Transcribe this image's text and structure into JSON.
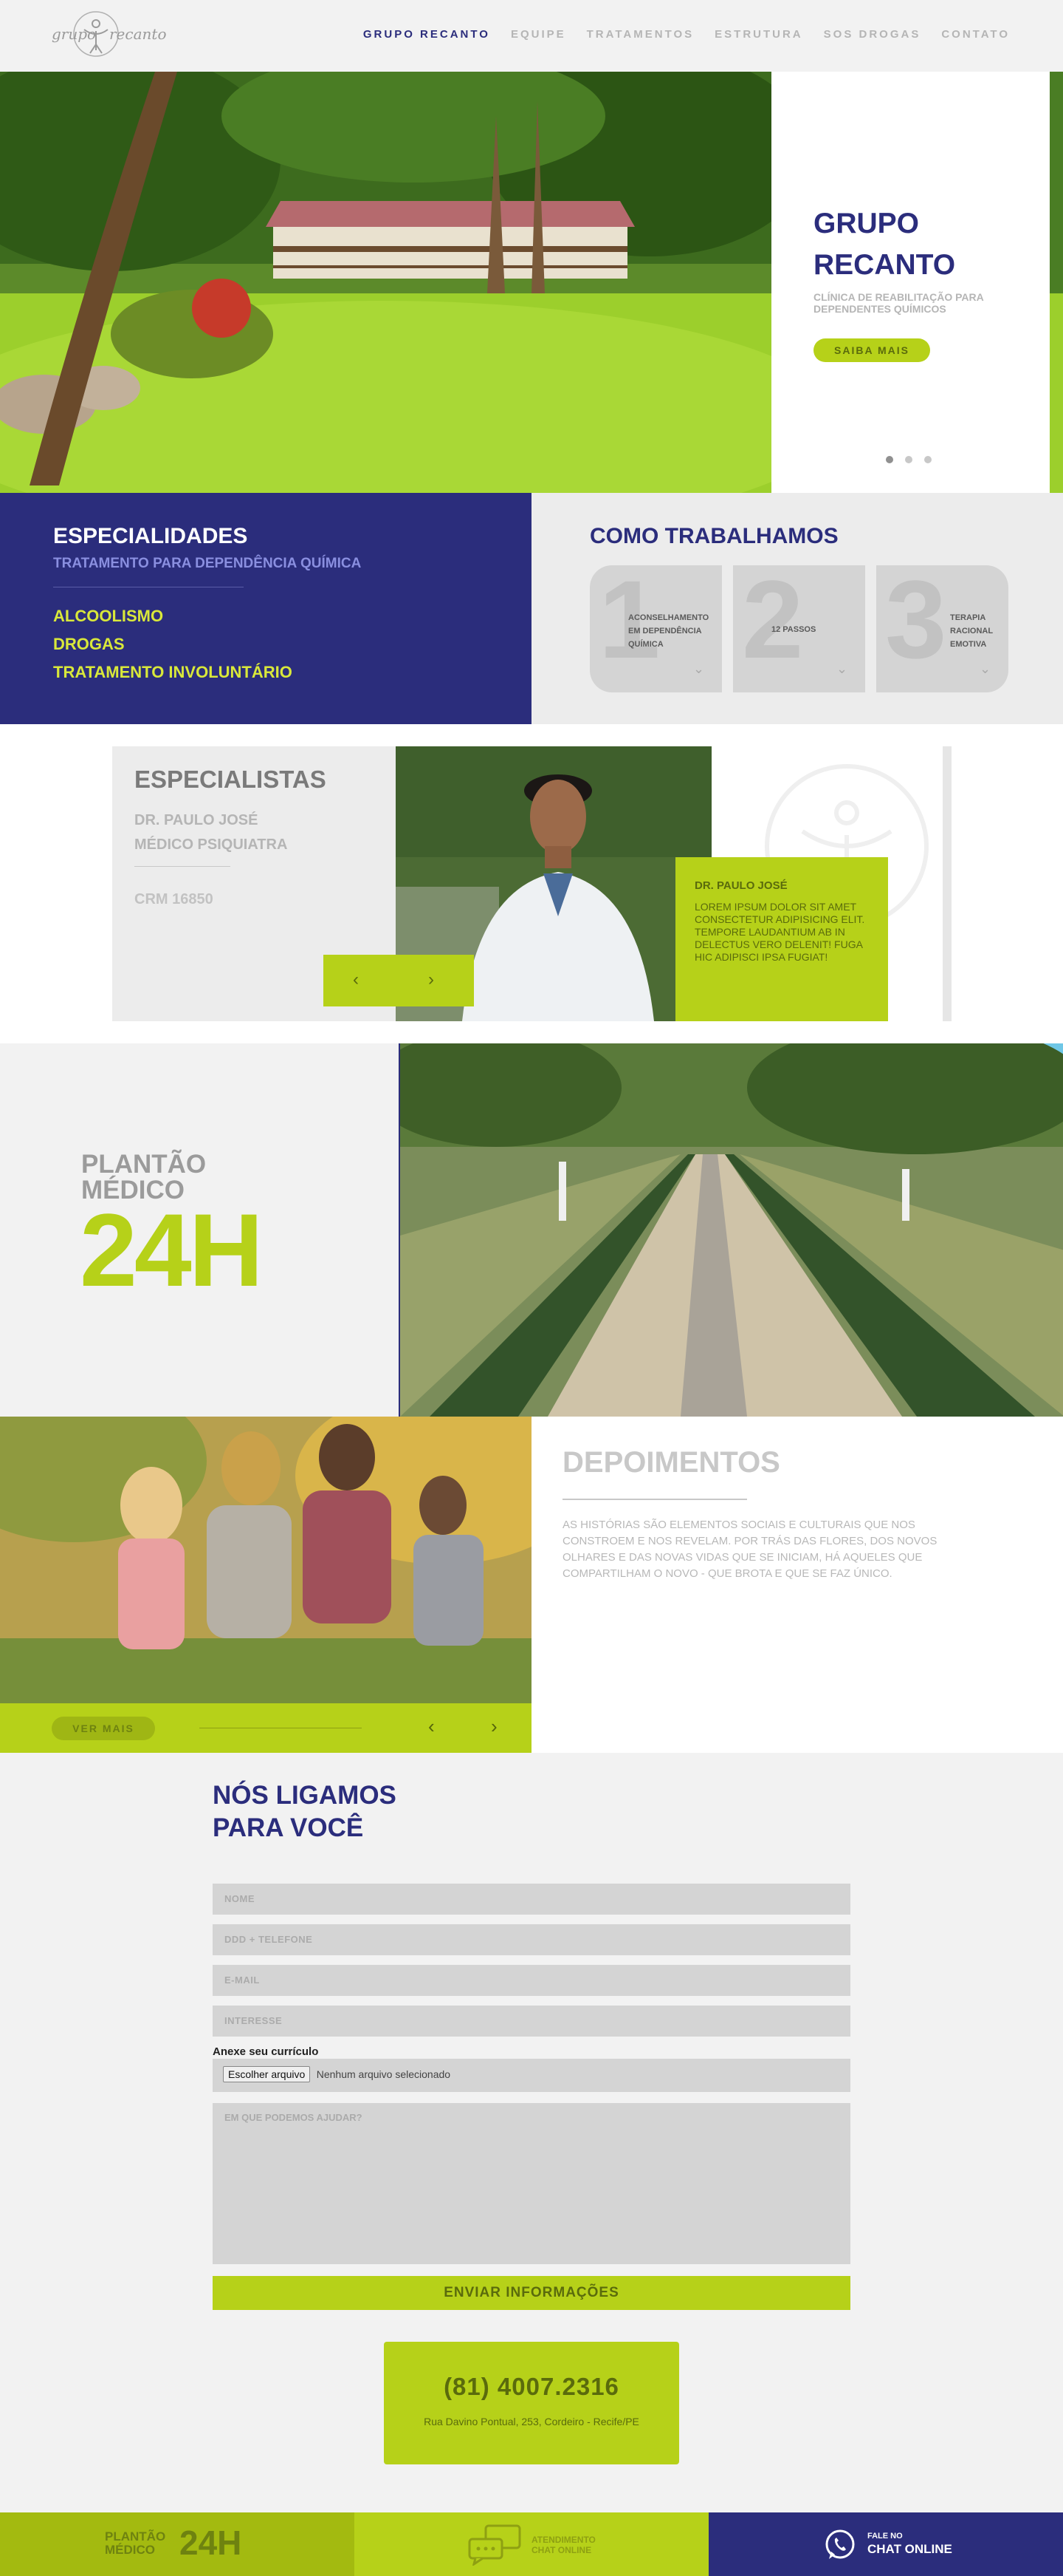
{
  "nav": {
    "logo_text_left": "grupo",
    "logo_text_right": "recanto",
    "items": [
      {
        "label": "GRUPO RECANTO",
        "active": true
      },
      {
        "label": "EQUIPE",
        "active": false
      },
      {
        "label": "TRATAMENTOS",
        "active": false
      },
      {
        "label": "ESTRUTURA",
        "active": false
      },
      {
        "label": "SOS DROGAS",
        "active": false
      },
      {
        "label": "CONTATO",
        "active": false
      }
    ]
  },
  "hero": {
    "title": "GRUPO RECANTO",
    "subtitle": "CLÍNICA DE REABILITAÇÃO PARA DEPENDENTES QUÍMICOS",
    "button": "SAIBA MAIS",
    "slides": 3,
    "active_slide": 1
  },
  "specialties": {
    "title": "ESPECIALIDADES",
    "subtitle": "TRATAMENTO PARA DEPENDÊNCIA QUÍMICA",
    "items": [
      "ALCOOLISMO",
      "DROGAS",
      "TRATAMENTO INVOLUNTÁRIO"
    ]
  },
  "how_we_work": {
    "title": "COMO TRABALHAMOS",
    "steps": [
      {
        "number": "1",
        "label": "ACONSELHAMENTO EM DEPENDÊNCIA QUÍMICA"
      },
      {
        "number": "2",
        "label": "12 PASSOS"
      },
      {
        "number": "3",
        "label": "TERAPIA RACIONAL EMOTIVA"
      }
    ]
  },
  "specialists": {
    "title": "ESPECIALISTAS",
    "name": "DR. PAULO JOSÉ",
    "role": "MÉDICO PSIQUIATRA",
    "crm": "CRM 16850",
    "card_name": "DR. PAULO JOSÉ",
    "card_text": "LOREM IPSUM DOLOR SIT AMET CONSECTETUR ADIPISICING ELIT. TEMPORE LAUDANTIUM AB IN DELECTUS VERO DELENIT! FUGA HIC ADIPISCI IPSA FUGIAT!",
    "prev": "‹",
    "next": "›"
  },
  "plantao": {
    "label_line1": "PLANTÃO",
    "label_line2": "MÉDICO",
    "hours": "24H"
  },
  "testimonials": {
    "title": "DEPOIMENTOS",
    "text": "AS HISTÓRIAS SÃO ELEMENTOS SOCIAIS E CULTURAIS QUE NOS CONSTROEM E NOS REVELAM. POR TRÁS DAS FLORES, DOS NOVOS OLHARES E DAS NOVAS VIDAS QUE SE INICIAM, HÁ AQUELES QUE COMPARTILHAM O NOVO - QUE BROTA E QUE SE FAZ ÚNICO.",
    "more_button": "VER MAIS",
    "prev": "‹",
    "next": "›"
  },
  "callus": {
    "title_line1": "NÓS LIGAMOS",
    "title_line2": "PARA VOCÊ",
    "fields": {
      "name": "NOME",
      "phone": "DDD + TELEFONE",
      "email": "E-MAIL",
      "interest": "INTERESSE",
      "message": "EM QUE PODEMOS AJUDAR?"
    },
    "attach_label": "Anexe seu currículo",
    "file_button": "Escolher arquivo",
    "file_status": "Nenhum arquivo selecionado",
    "submit": "ENVIAR INFORMAÇÕES",
    "phone": "(81) 4007.2316",
    "address": "Rua Davino Pontual, 253, Cordeiro - Recife/PE"
  },
  "footer": {
    "plantao_line1": "PLANTÃO",
    "plantao_line2": "MÉDICO",
    "plantao_hours": "24H",
    "chat_line1": "ATENDIMENTO",
    "chat_line2": "CHAT ONLINE",
    "whatsapp_small": "FALE NO",
    "whatsapp_big": "CHAT ONLINE"
  },
  "colors": {
    "brand_navy": "#2b2d7c",
    "brand_lime": "#b6d119",
    "background": "#f2f2f2"
  }
}
